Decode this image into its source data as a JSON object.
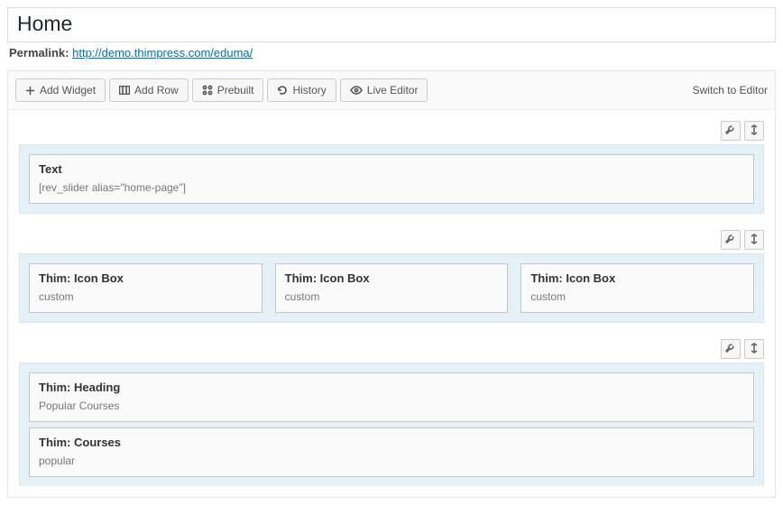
{
  "title": "Home",
  "permalink": {
    "label": "Permalink:",
    "url": "http://demo.thimpress.com/eduma/"
  },
  "toolbar": {
    "add_widget": "Add Widget",
    "add_row": "Add Row",
    "prebuilt": "Prebuilt",
    "history": "History",
    "live_editor": "Live Editor",
    "switch": "Switch to Editor"
  },
  "rows": [
    {
      "cells": [
        [
          {
            "title": "Text",
            "desc": "[rev_slider alias=\"home-page\"]"
          }
        ]
      ]
    },
    {
      "cells": [
        [
          {
            "title": "Thim: Icon Box",
            "desc": "custom"
          }
        ],
        [
          {
            "title": "Thim: Icon Box",
            "desc": "custom"
          }
        ],
        [
          {
            "title": "Thim: Icon Box",
            "desc": "custom"
          }
        ]
      ]
    },
    {
      "cells": [
        [
          {
            "title": "Thim: Heading",
            "desc": "Popular Courses"
          },
          {
            "title": "Thim: Courses",
            "desc": "popular"
          }
        ]
      ]
    }
  ]
}
